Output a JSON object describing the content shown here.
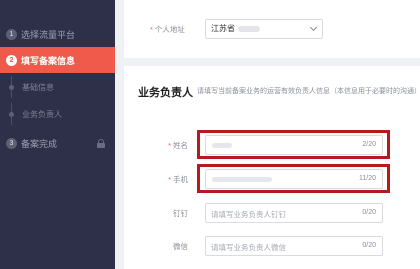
{
  "sidebar": {
    "steps": [
      {
        "num": "1",
        "label": "选择流量平台"
      },
      {
        "num": "2",
        "label": "填写备案信息"
      },
      {
        "num": "3",
        "label": "备案完成"
      }
    ],
    "substeps": [
      {
        "label": "基础信息"
      },
      {
        "label": "业务负责人"
      }
    ]
  },
  "form": {
    "address_label": "个人地址",
    "address_value": "江苏省",
    "section_title": "业务负责人",
    "section_desc": "请填写当前备案业务的运营有效负责人信息（本信息用于必要时的沟通）",
    "fields": {
      "name": {
        "label": "姓名",
        "counter": "2/20"
      },
      "phone": {
        "label": "手机",
        "counter": "11/20"
      },
      "dingtalk": {
        "label": "钉钉",
        "placeholder": "请填写业务负责人钉钉",
        "counter": "0/20"
      },
      "wechat": {
        "label": "微信",
        "placeholder": "请填写业务负责人微信",
        "counter": "0/20"
      }
    }
  },
  "colors": {
    "accent": "#f05a4a",
    "sidebar": "#2d3048",
    "highlight": "#b51a1f"
  }
}
